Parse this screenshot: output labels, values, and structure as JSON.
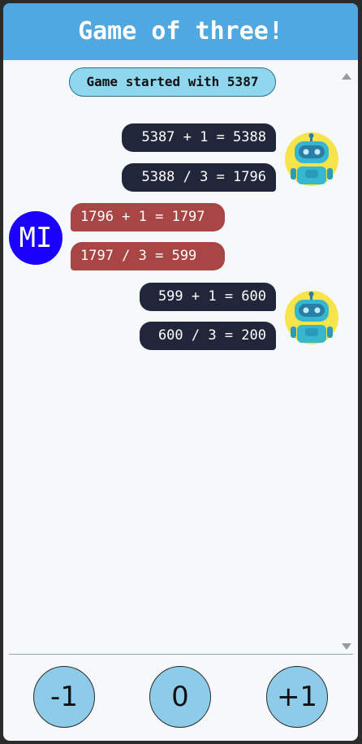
{
  "header": {
    "title": "Game of three!"
  },
  "notice": {
    "text": "Game started with 5387"
  },
  "messages": [
    {
      "text": "5387 + 1 = 5388"
    },
    {
      "text": "5388 / 3 = 1796"
    },
    {
      "text": "1796 + 1 = 1797"
    },
    {
      "text": "1797 / 3 = 599"
    },
    {
      "text": "599 + 1 = 600"
    },
    {
      "text": "600 / 3 = 200"
    }
  ],
  "user": {
    "initials": "MI",
    "color": "#1a00ff"
  },
  "controls": {
    "minus": "-1",
    "zero": "0",
    "plus": "+1"
  },
  "colors": {
    "header": "#4fa8df",
    "bot_bubble": "#22263a",
    "user_bubble": "#a84545",
    "button": "#8ecbe9"
  }
}
